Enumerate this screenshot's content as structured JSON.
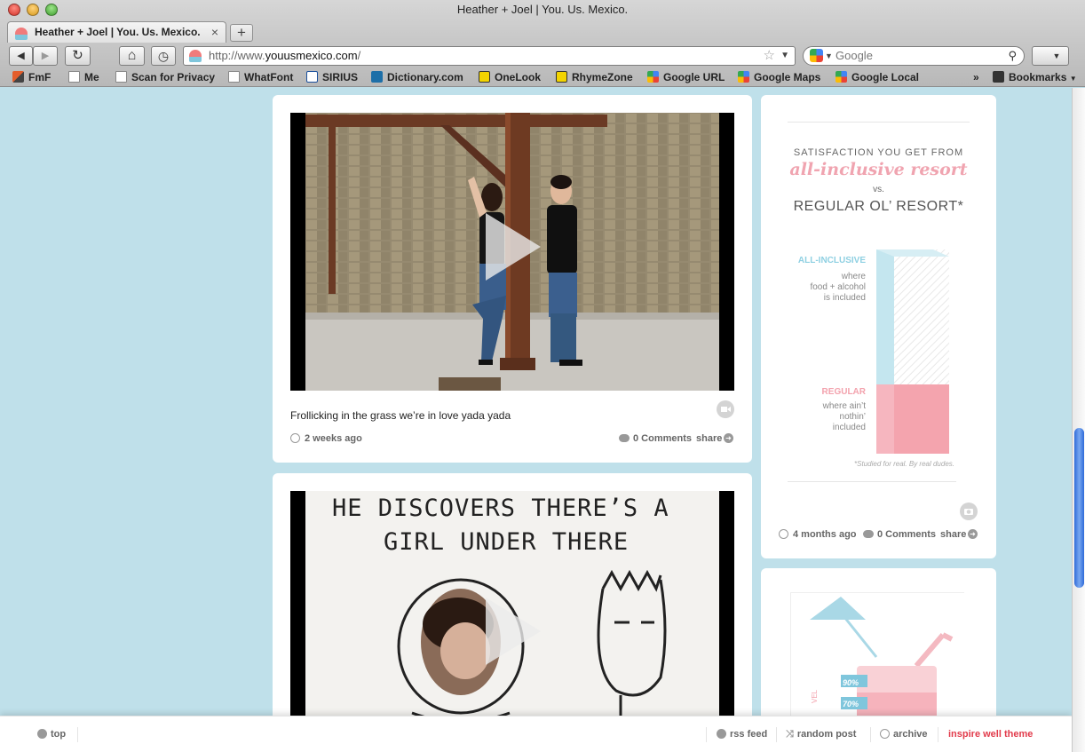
{
  "window": {
    "title": "Heather + Joel | You. Us. Mexico."
  },
  "tab": {
    "title": "Heather + Joel | You. Us. Mexico.",
    "close_glyph": "×",
    "new_tab_glyph": "+"
  },
  "nav": {
    "url_scheme": "http://www.",
    "url_host": "youusmexico.com",
    "url_path": "/",
    "search_placeholder": "Google",
    "back_glyph": "◀",
    "forward_glyph": "▶",
    "reload_glyph": "↻",
    "home_glyph": "⌂",
    "history_glyph": "◷",
    "star_glyph": "☆",
    "drop_glyph": "▼",
    "search_glyph": "⚲"
  },
  "bookmarks": [
    {
      "label": "FmF",
      "icon": "fmf-icon"
    },
    {
      "label": "Me",
      "icon": "page-icon"
    },
    {
      "label": "Scan for Privacy",
      "icon": "page-icon"
    },
    {
      "label": "WhatFont",
      "icon": "page-icon"
    },
    {
      "label": "SIRIUS",
      "icon": "sirius-icon"
    },
    {
      "label": "Dictionary.com",
      "icon": "dictionary-icon"
    },
    {
      "label": "OneLook",
      "icon": "onelook-icon"
    },
    {
      "label": "RhymeZone",
      "icon": "rhymezone-icon"
    },
    {
      "label": "Google URL",
      "icon": "google-icon"
    },
    {
      "label": "Google Maps",
      "icon": "google-maps-icon"
    },
    {
      "label": "Google Local",
      "icon": "google-icon"
    },
    {
      "label": "Bookmarks",
      "icon": "bookmarks-icon"
    }
  ],
  "bookmarks_overflow": "»",
  "posts": [
    {
      "caption": "Frollicking in the grass we’re in love yada yada",
      "time_ago": "2 weeks ago",
      "comments": "0 Comments",
      "share": "share"
    },
    {
      "caption": "",
      "drawing_text_line1": "HE DISCOVERS THERE’S A",
      "drawing_text_line2": "GIRL UNDER THERE"
    }
  ],
  "sidebar_posts": [
    {
      "heading_line1": "SATISFACTION YOU GET FROM",
      "heading_script": "all-inclusive resort",
      "heading_vs": "vs.",
      "heading_line2": "REGULAR OL’ RESORT*",
      "label_all_inclusive": "ALL-INCLUSIVE",
      "label_all_inclusive_sub": [
        "where",
        "food + alcohol",
        "is included"
      ],
      "label_regular": "REGULAR",
      "label_regular_sub": [
        "where ain’t",
        "nothin’",
        "included"
      ],
      "footnote": "*Studied for real. By real dudes.",
      "bar_all_inclusive_fraction": 1.0,
      "bar_regular_fraction": 0.34,
      "time_ago": "4 months ago",
      "comments": "0 Comments",
      "share": "share"
    },
    {
      "label_90": "90%",
      "label_70": "70%",
      "side_text": "VEL"
    }
  ],
  "footer": {
    "top": "top",
    "rss": "rss feed",
    "random": "random post",
    "archive": "archive",
    "theme": "inspire well theme"
  },
  "colors": {
    "page_bg": "#bfe0ea",
    "accent_pink": "#f3a2ad",
    "accent_blue": "#8fd0e2",
    "theme_link": "#e23b4b"
  }
}
